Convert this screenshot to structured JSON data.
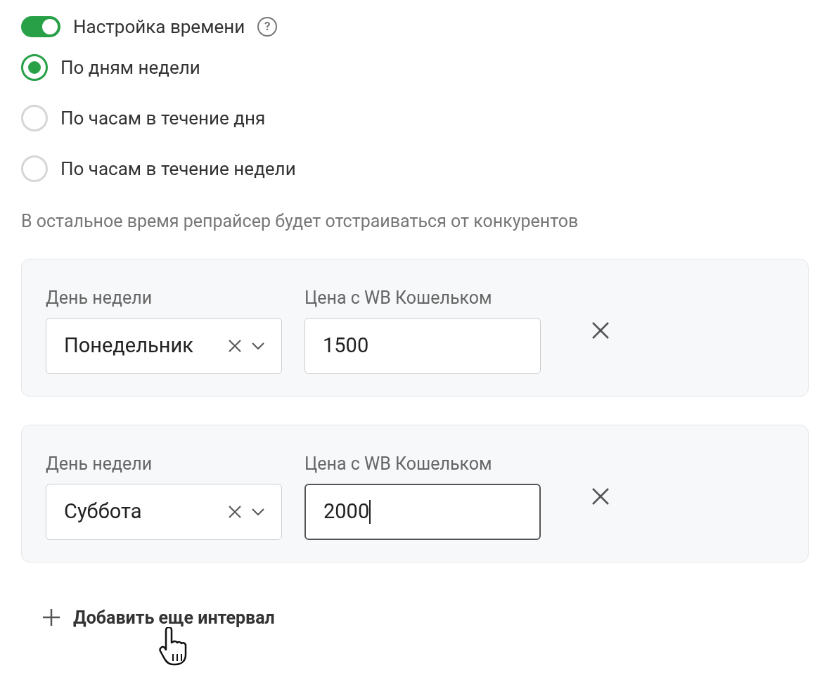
{
  "toggle": {
    "label": "Настройка времени",
    "on": true,
    "help": "?"
  },
  "modes": [
    {
      "label": "По дням недели",
      "selected": true
    },
    {
      "label": "По часам в течение дня",
      "selected": false
    },
    {
      "label": "По часам в течение недели",
      "selected": false
    }
  ],
  "note": "В остальное время репрайсер будет отстраиваться от конкурентов",
  "intervals": [
    {
      "day_label": "День недели",
      "day": "Понедельник",
      "price_label": "Цена с WB Кошельком",
      "price": "1500",
      "focused": false
    },
    {
      "day_label": "День недели",
      "day": "Суббота",
      "price_label": "Цена с WB Кошельком",
      "price": "2000",
      "focused": true
    }
  ],
  "add_button": "Добавить еще интервал"
}
